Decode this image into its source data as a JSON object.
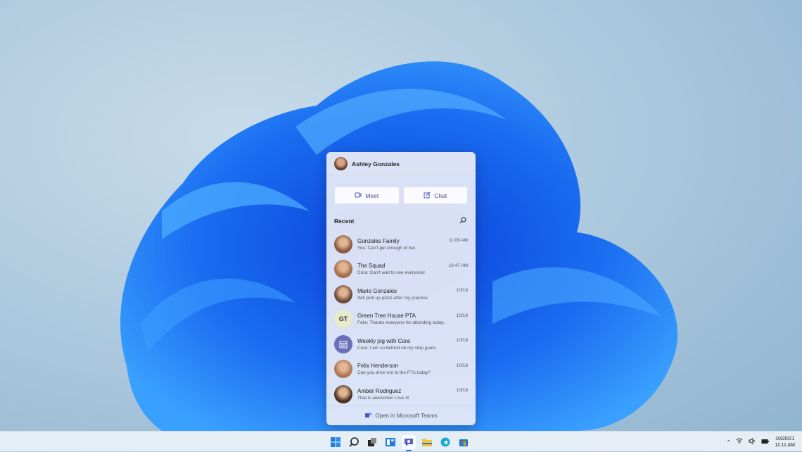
{
  "teams_flyout": {
    "user_name": "Ashley Gonzales",
    "meet_label": "Meet",
    "chat_label": "Chat",
    "recent_label": "Recent",
    "conversations": [
      {
        "name": "Gonzales Family",
        "message": "You: Can't get enough of her.",
        "time": "11:09 AM",
        "avatar": "photo"
      },
      {
        "name": "The Squad",
        "message": "Cora: Can't wait to see everyone!",
        "time": "10:47 AM",
        "avatar": "photo"
      },
      {
        "name": "Mario Gonzales",
        "message": "Will pick up pizza after my practice.",
        "time": "10/19",
        "avatar": "photo"
      },
      {
        "name": "Green Tree House PTA",
        "message": "Felix: Thanks everyone for attending today.",
        "time": "10/19",
        "avatar": "initials",
        "initials": "GT"
      },
      {
        "name": "Weekly jog with Cora",
        "message": "Cora: I am so behind on my step goals.",
        "time": "10/18",
        "avatar": "calendar-icon"
      },
      {
        "name": "Felix Henderson",
        "message": "Can you drive me to the PTA today?",
        "time": "10/18",
        "avatar": "photo"
      },
      {
        "name": "Amber Rodriguez",
        "message": "That is awesome! Love it!",
        "time": "10/18",
        "avatar": "photo"
      }
    ],
    "footer_label": "Open in Microsoft Teams",
    "accent_color": "#4b53bc"
  },
  "taskbar": {
    "icons": [
      "start-icon",
      "search-icon",
      "task-view-icon",
      "widgets-icon",
      "teams-chat-icon",
      "file-explorer-icon",
      "edge-icon",
      "store-icon"
    ],
    "active": "teams-chat-icon",
    "date": "10/20/21",
    "time": "11:11 AM"
  }
}
